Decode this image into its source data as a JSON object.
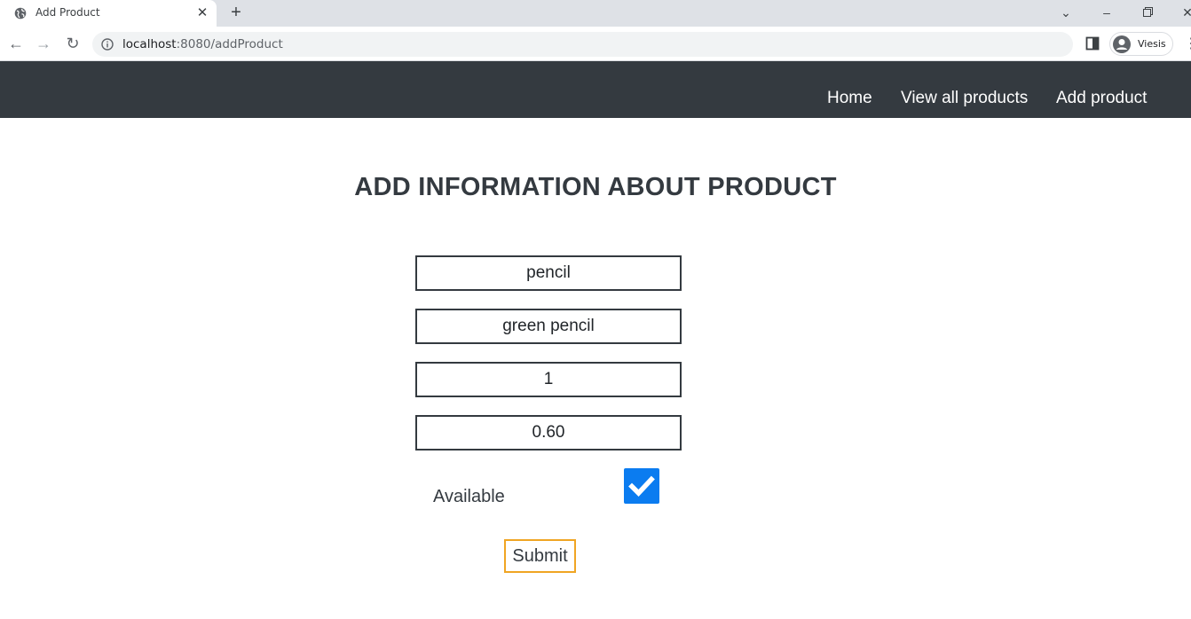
{
  "browser": {
    "tab_title": "Add Product",
    "url_host": "localhost",
    "url_rest": ":8080/addProduct",
    "profile_name": "Viesis"
  },
  "nav": {
    "links": [
      "Home",
      "View all products",
      "Add product"
    ]
  },
  "page": {
    "title": "ADD INFORMATION ABOUT PRODUCT",
    "fields": {
      "name": "pencil",
      "description": "green pencil",
      "quantity": "1",
      "price": "0.60"
    },
    "available_label": "Available",
    "available_checked": true,
    "submit_label": "Submit"
  },
  "colors": {
    "navbar_bg": "#343a40",
    "checkbox_accent": "#0b7cf0",
    "submit_border": "#f0a523"
  }
}
